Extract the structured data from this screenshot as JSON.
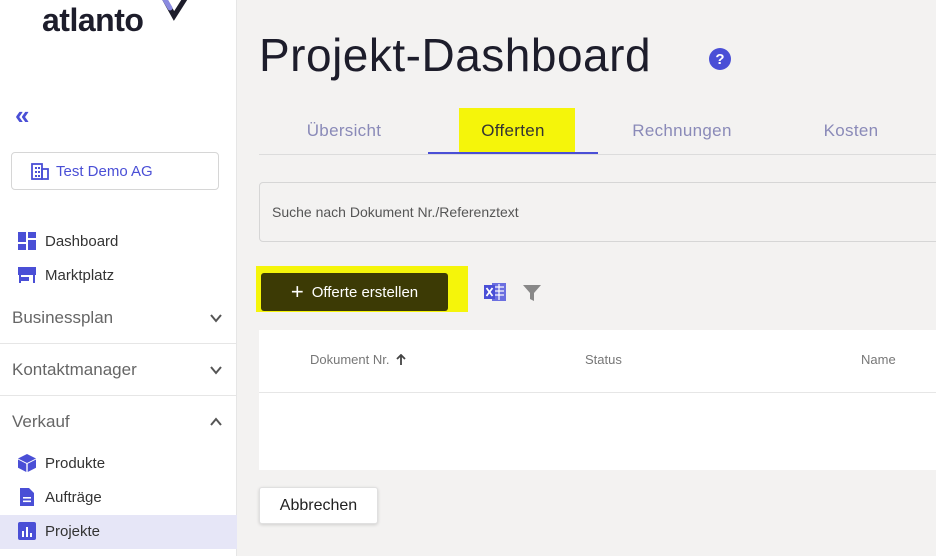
{
  "brand": {
    "logo_text": "atlanto"
  },
  "sidebar": {
    "collapse_glyph": "«",
    "company": "Test Demo AG",
    "items_top": [
      {
        "label": "Dashboard",
        "icon": "dashboard-icon"
      },
      {
        "label": "Marktplatz",
        "icon": "store-icon"
      }
    ],
    "sections": [
      {
        "label": "Businessplan",
        "expanded": false
      },
      {
        "label": "Kontaktmanager",
        "expanded": false
      },
      {
        "label": "Verkauf",
        "expanded": true
      }
    ],
    "verkauf_items": [
      {
        "label": "Produkte",
        "icon": "cube-icon"
      },
      {
        "label": "Aufträge",
        "icon": "document-icon"
      },
      {
        "label": "Projekte",
        "icon": "chart-icon",
        "active": true
      }
    ]
  },
  "header": {
    "title": "Projekt-Dashboard",
    "help_glyph": "?"
  },
  "tabs": [
    {
      "label": "Übersicht"
    },
    {
      "label": "Offerten",
      "active": true
    },
    {
      "label": "Rechnungen"
    },
    {
      "label": "Kosten"
    }
  ],
  "search": {
    "placeholder": "Suche nach Dokument Nr./Referenztext"
  },
  "actions": {
    "create_label": "Offerte erstellen",
    "cancel_label": "Abbrechen"
  },
  "table": {
    "columns": [
      {
        "label": "Dokument Nr.",
        "sorted": "asc"
      },
      {
        "label": "Status"
      },
      {
        "label": "Name"
      }
    ],
    "rows": []
  },
  "colors": {
    "accent": "#4a4fd6",
    "highlight": "#f5f50a",
    "primary_button": "#3c3a05"
  }
}
